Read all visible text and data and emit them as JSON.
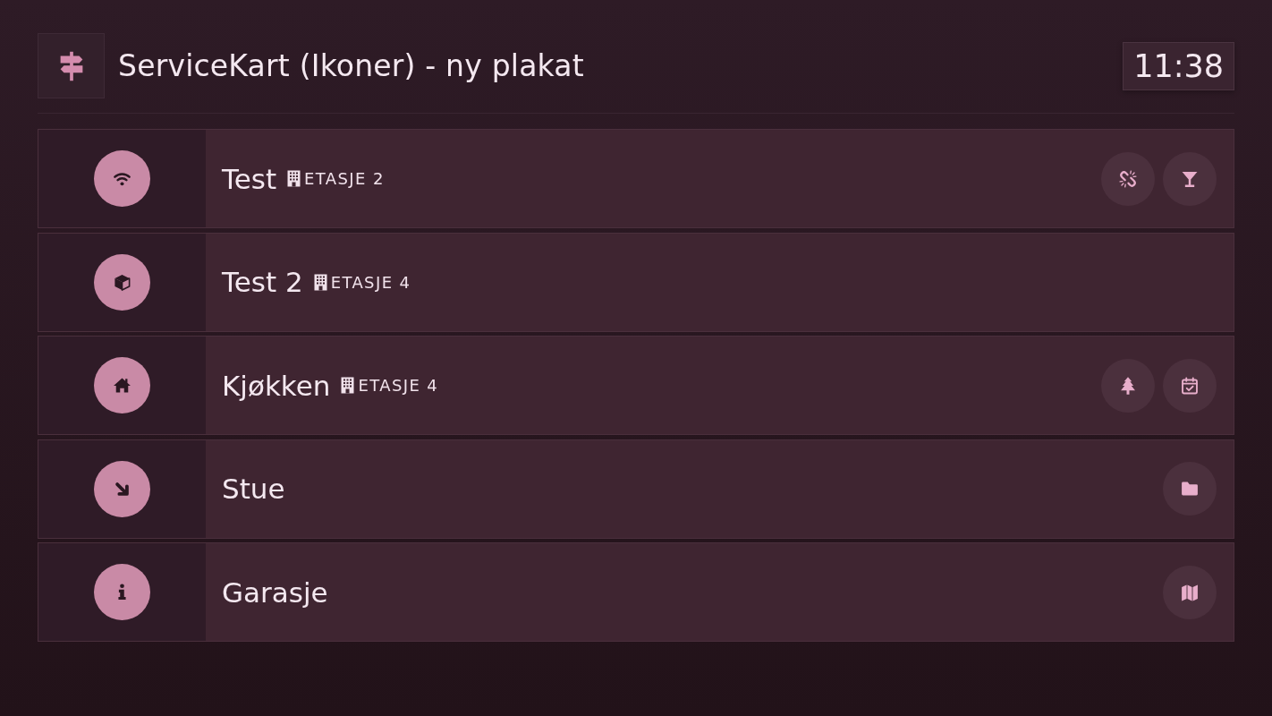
{
  "header": {
    "title": "ServiceKart (Ikoner) - ny plakat",
    "clock": "11:38"
  },
  "rooms": [
    {
      "name": "Test",
      "kind": "wifi",
      "floor": "ETASJE 2",
      "services": [
        {
          "kind": "broken-link"
        },
        {
          "kind": "cocktail"
        }
      ]
    },
    {
      "name": "Test 2",
      "kind": "cube",
      "floor": "ETASJE 4"
    },
    {
      "name": "Kjøkken",
      "kind": "home",
      "floor": "ETASJE 4",
      "services": [
        {
          "kind": "tree"
        },
        {
          "kind": "calendar"
        }
      ]
    },
    {
      "name": "Stue",
      "kind": "arrow",
      "services": [
        {
          "kind": "folder"
        }
      ]
    },
    {
      "name": "Garasje",
      "kind": "info",
      "services": [
        {
          "kind": "map"
        }
      ]
    }
  ]
}
